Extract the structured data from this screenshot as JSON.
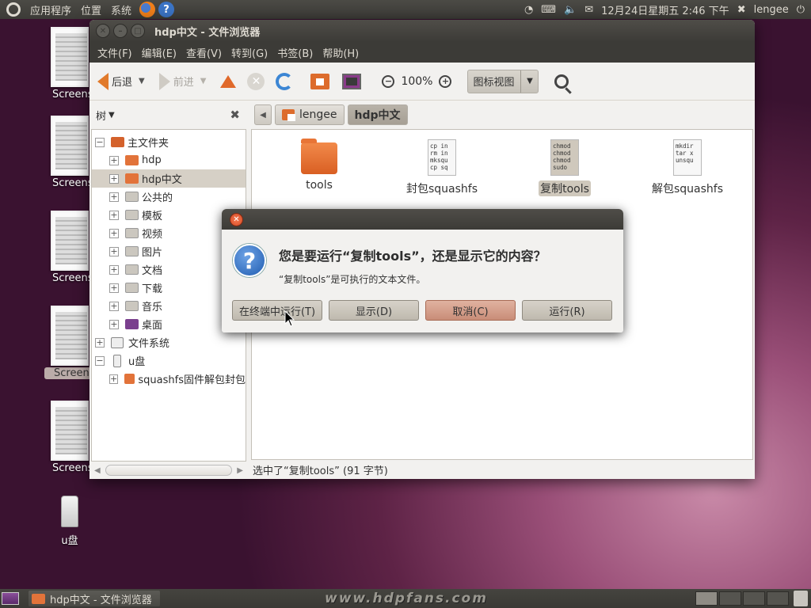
{
  "top_panel": {
    "menus": [
      "应用程序",
      "位置",
      "系统"
    ],
    "clock": "12月24日星期五  2:46 下午",
    "user": "lengee",
    "tray_icons": [
      "network-icon",
      "keyboard-icon",
      "volume-icon",
      "mail-icon"
    ]
  },
  "desktop": {
    "screenshot_icons": [
      "Screens",
      "Screens",
      "Screens",
      "Screens",
      "Screens"
    ],
    "usb_label": "u盘"
  },
  "file_browser": {
    "title": "hdp中文 - 文件浏览器",
    "menu": [
      "文件(F)",
      "编辑(E)",
      "查看(V)",
      "转到(G)",
      "书签(B)",
      "帮助(H)"
    ],
    "toolbar": {
      "back": "后退",
      "forward": "前进",
      "zoom": "100%",
      "view_mode": "图标视图"
    },
    "sidebar": {
      "header": "树",
      "tree": [
        {
          "label": "主文件夹",
          "level": 0,
          "expanded": true
        },
        {
          "label": "hdp",
          "level": 1
        },
        {
          "label": "hdp中文",
          "level": 1,
          "selected": true
        },
        {
          "label": "公共的",
          "level": 1
        },
        {
          "label": "模板",
          "level": 1
        },
        {
          "label": "视频",
          "level": 1
        },
        {
          "label": "图片",
          "level": 1
        },
        {
          "label": "文档",
          "level": 1
        },
        {
          "label": "下载",
          "level": 1
        },
        {
          "label": "音乐",
          "level": 1
        },
        {
          "label": "桌面",
          "level": 1
        },
        {
          "label": "文件系统",
          "level": 0
        },
        {
          "label": "u盘",
          "level": 0,
          "expanded": true
        },
        {
          "label": "squashfs固件解包封包",
          "level": 1
        }
      ]
    },
    "path_bar": {
      "crumbs": [
        "lengee",
        "hdp中文"
      ]
    },
    "files": [
      {
        "name": "tools",
        "type": "folder"
      },
      {
        "name": "封包squashfs",
        "type": "text",
        "preview": "cp in\nrm in\nmksqu\ncp sq"
      },
      {
        "name": "复制tools",
        "type": "text",
        "preview": "chmod\nchmod\nchmod\nsudo",
        "selected": true
      },
      {
        "name": "解包squashfs",
        "type": "text",
        "preview": "mkdir\ntar x\nunsqu"
      }
    ],
    "status": "选中了“复制tools” (91 字节)"
  },
  "dialog": {
    "heading": "您是要运行“复制tools”，还是显示它的内容？",
    "message": "“复制tools”是可执行的文本文件。",
    "buttons": {
      "run_in_terminal": "在终端中运行(T)",
      "display": "显示(D)",
      "cancel": "取消(C)",
      "run": "运行(R)"
    }
  },
  "bottom_panel": {
    "task": "hdp中文 - 文件浏览器",
    "watermark": "www.hdpfans.com"
  }
}
